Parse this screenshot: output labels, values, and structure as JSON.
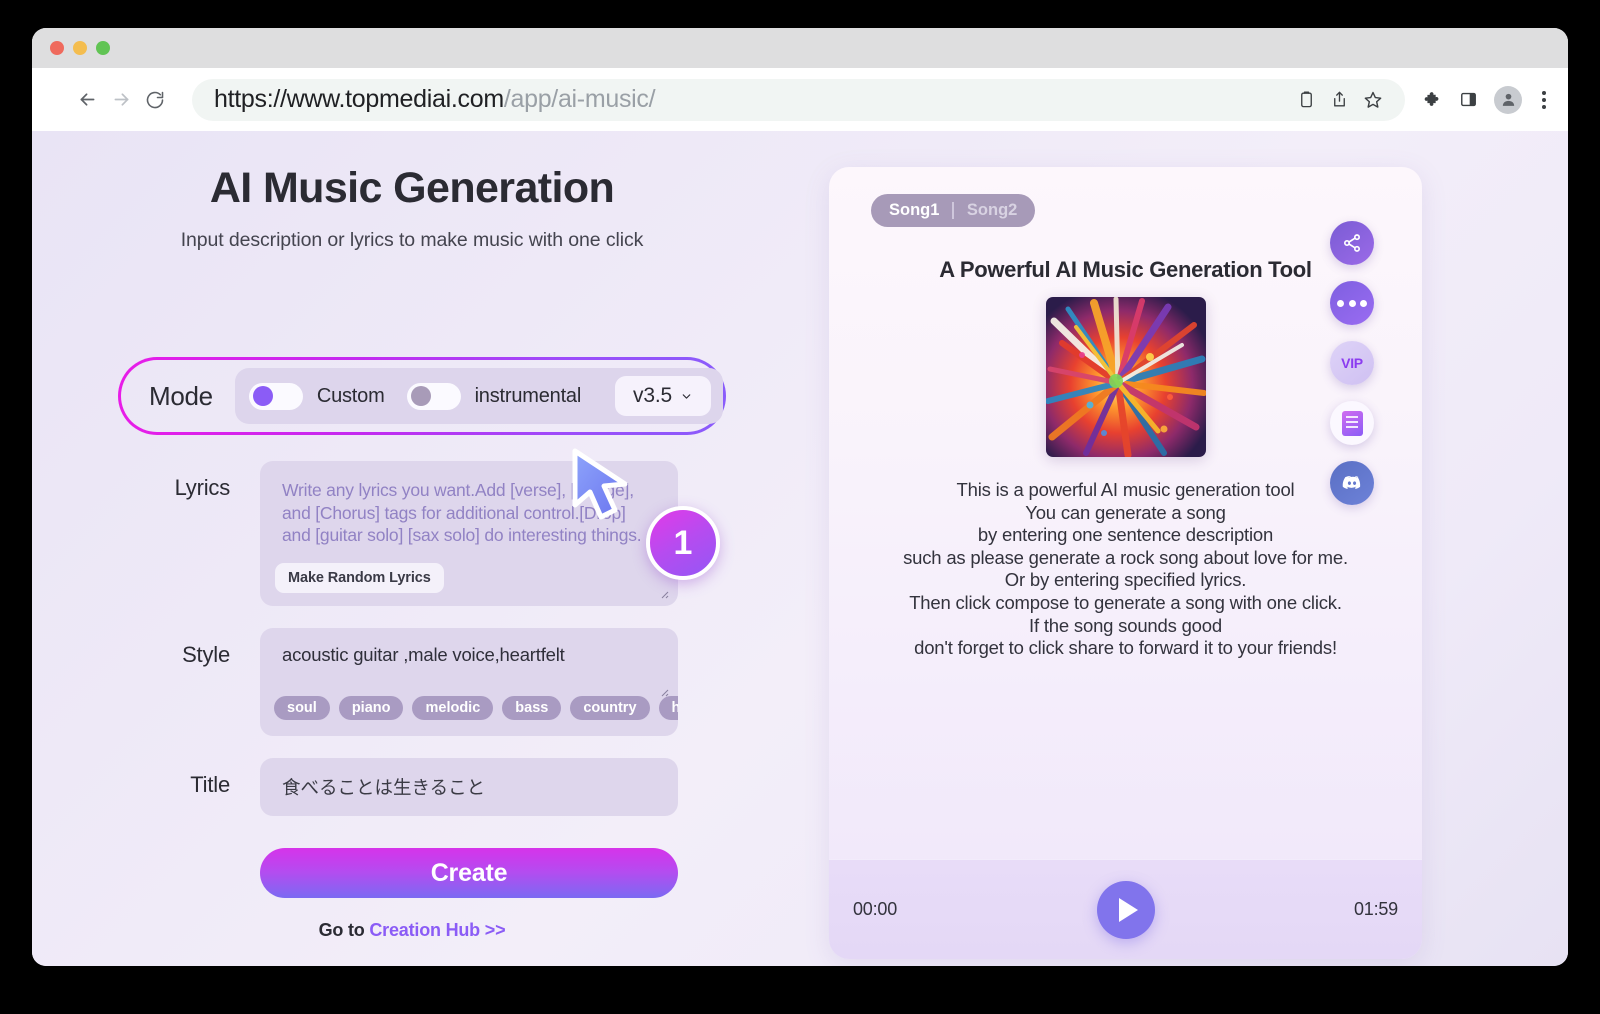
{
  "browser": {
    "url_host": "https://www.topmediai.com",
    "url_path": "/app/ai-music/",
    "back_icon": "back-arrow-icon",
    "forward_icon": "forward-arrow-icon",
    "reload_icon": "reload-icon",
    "clipboard_icon": "clipboard-icon",
    "share_icon": "share-icon",
    "bookmark_icon": "star-icon",
    "extensions_icon": "puzzle-icon",
    "sidepanel_icon": "side-panel-icon",
    "profile_icon": "profile-avatar-icon",
    "menu_icon": "kebab-menu-icon"
  },
  "header": {
    "title": "AI Music Generation",
    "subtitle": "Input description or lyrics to make music with one click"
  },
  "mode": {
    "label": "Mode",
    "custom_toggle": {
      "label": "Custom",
      "state": "on"
    },
    "instrumental_toggle": {
      "label": "instrumental",
      "state": "off"
    },
    "version": "v3.5",
    "highlight_color": "#c32af0"
  },
  "form": {
    "lyrics": {
      "label": "Lyrics",
      "placeholder": "Write any lyrics you want.Add [verse], [Bridge], and [Chorus] tags for additional control.[Drop] and [guitar solo] [sax solo] do interesting things.",
      "random_button": "Make Random Lyrics"
    },
    "style": {
      "label": "Style",
      "value": "acoustic guitar ,male voice,heartfelt",
      "tags": [
        "soul",
        "piano",
        "melodic",
        "bass",
        "country",
        "hard rock"
      ]
    },
    "title": {
      "label": "Title",
      "value": "食べることは生きること"
    },
    "create_button": "Create",
    "hub_prefix": "Go to ",
    "hub_link": "Creation Hub >>"
  },
  "preview": {
    "tabs": [
      {
        "label": "Song1",
        "active": true
      },
      {
        "label": "Song2",
        "active": false
      }
    ],
    "title": "A Powerful AI Music Generation Tool",
    "artwork": "colorful-paint-explosion-album-art",
    "description_lines": [
      "This is a powerful AI music generation tool",
      "You can generate a song",
      "by entering one sentence description",
      "such as please generate a rock song about love for me.",
      "Or by entering specified lyrics.",
      "Then click compose to generate a song with one click.",
      "If the song sounds good",
      "don't forget to click share to forward it to your friends!"
    ],
    "player": {
      "current_time": "00:00",
      "total_time": "01:59",
      "play_icon": "play-icon"
    }
  },
  "rail": {
    "items": [
      {
        "name": "share-icon",
        "label": ""
      },
      {
        "name": "more-options-icon",
        "label": ""
      },
      {
        "name": "vip-icon",
        "label": "VIP"
      },
      {
        "name": "feedback-book-icon",
        "label": ""
      },
      {
        "name": "discord-icon",
        "label": ""
      }
    ]
  },
  "annotation": {
    "step_number": "1",
    "cursor": "arrow-cursor"
  }
}
